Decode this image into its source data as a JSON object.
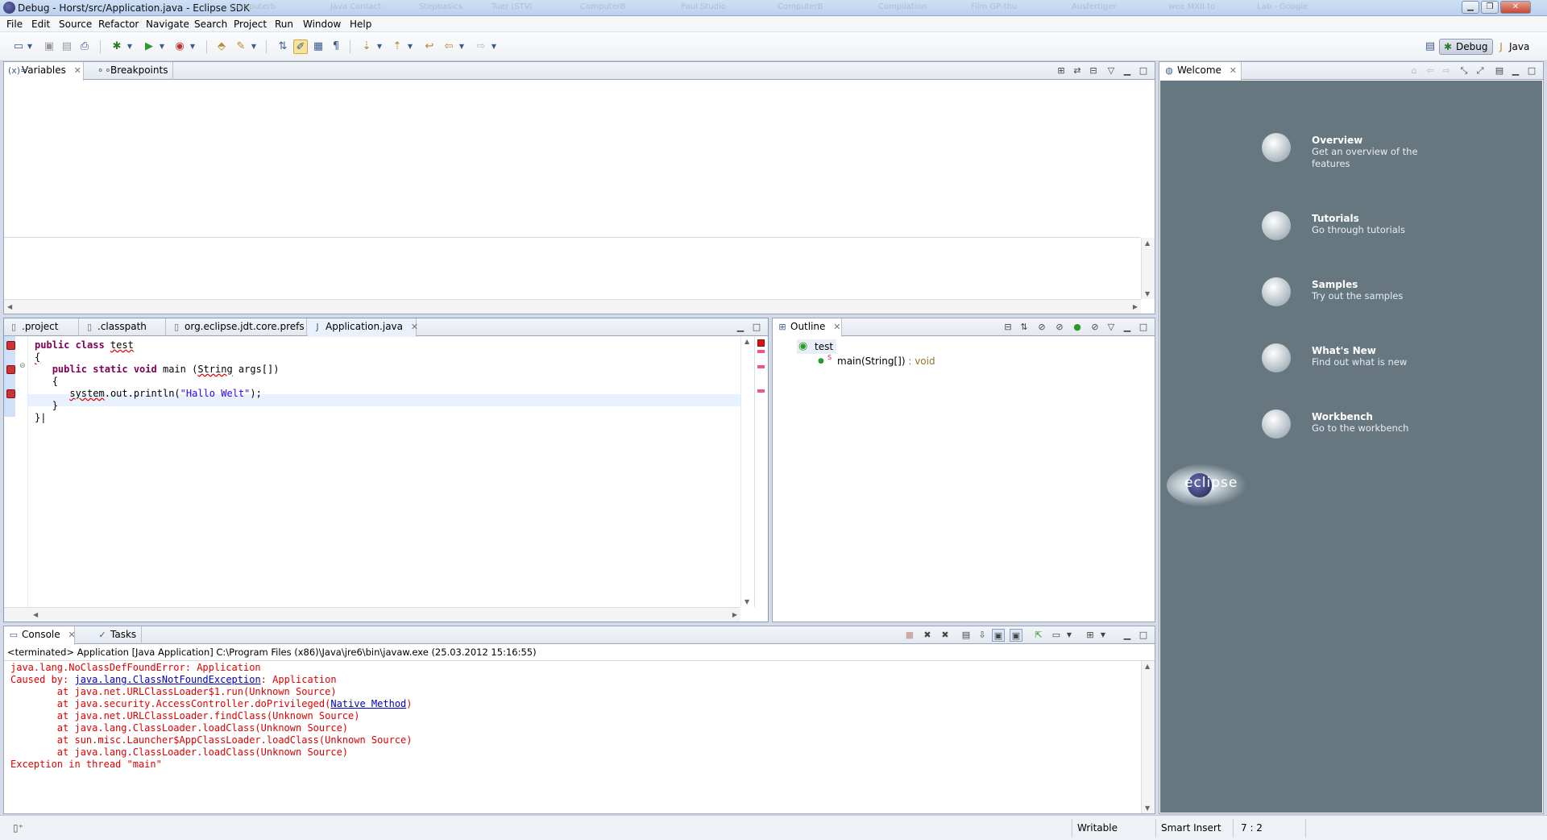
{
  "window": {
    "title": "Debug - Horst/src/Application.java - Eclipse SDK",
    "taskbar_ghosts": [
      "Computerb",
      "Java Contact",
      "Stepbasics",
      "Tuer (STVI",
      "ComputerB",
      "Paul Studio",
      "ComputerB",
      "Compilation",
      "Film GP-thu",
      "Ausfertiger",
      "wee MXII to",
      "Lab - Google"
    ],
    "controls": [
      "minimize",
      "maximize",
      "close"
    ]
  },
  "menu": [
    "File",
    "Edit",
    "Source",
    "Refactor",
    "Navigate",
    "Search",
    "Project",
    "Run",
    "Window",
    "Help"
  ],
  "perspectives": [
    {
      "label": "Debug",
      "active": true
    },
    {
      "label": "Java",
      "active": false
    }
  ],
  "variables_view": {
    "tabs": [
      {
        "label": "Variables",
        "active": true,
        "closable": true
      },
      {
        "label": "Breakpoints",
        "active": false,
        "closable": false
      }
    ]
  },
  "editor": {
    "tabs": [
      {
        "label": ".project",
        "active": false
      },
      {
        "label": ".classpath",
        "active": false
      },
      {
        "label": "org.eclipse.jdt.core.prefs",
        "active": false
      },
      {
        "label": "Application.java",
        "active": true
      }
    ],
    "code": {
      "l1_kw": "public class ",
      "l1_name": "test",
      "l2": "{",
      "l3_kw": "public static void ",
      "l3_rest_a": "main (",
      "l3_type": "String",
      "l3_rest_b": " args[])",
      "l4": "{",
      "l5_err": "system",
      "l5_rest": ".out.println(",
      "l5_str": "\"Hallo Welt\"",
      "l5_end": ");",
      "l6": "}",
      "l7": "}"
    }
  },
  "outline": {
    "tab": "Outline",
    "class_name": "test",
    "method_name": "main(String[])",
    "method_type": " : void",
    "static_marker": "S"
  },
  "welcome": {
    "tab": "Welcome",
    "items": [
      {
        "title": "Overview",
        "desc": "Get an overview of the features"
      },
      {
        "title": "Tutorials",
        "desc": "Go through tutorials"
      },
      {
        "title": "Samples",
        "desc": "Try out the samples"
      },
      {
        "title": "What's New",
        "desc": "Find out what is new"
      },
      {
        "title": "Workbench",
        "desc": "Go to the workbench"
      }
    ],
    "logo": "eclipse"
  },
  "console": {
    "tabs": [
      {
        "label": "Console",
        "active": true
      },
      {
        "label": "Tasks",
        "active": false
      }
    ],
    "header": "<terminated> Application [Java Application] C:\\Program Files (x86)\\Java\\jre6\\bin\\javaw.exe (25.03.2012 15:16:55)",
    "line1": "java.lang.NoClassDefFoundError: Application",
    "line2_a": "Caused by: ",
    "line2_link": "java.lang.ClassNotFoundException",
    "line2_b": ": Application",
    "line3": "\tat java.net.URLClassLoader$1.run(Unknown Source)",
    "line4_a": "\tat java.security.AccessController.doPrivileged(",
    "line4_link": "Native Method",
    "line4_b": ")",
    "line5": "\tat java.net.URLClassLoader.findClass(Unknown Source)",
    "line6": "\tat java.lang.ClassLoader.loadClass(Unknown Source)",
    "line7": "\tat sun.misc.Launcher$AppClassLoader.loadClass(Unknown Source)",
    "line8": "\tat java.lang.ClassLoader.loadClass(Unknown Source)",
    "line9": "Exception in thread \"main\""
  },
  "status": {
    "writable": "Writable",
    "insert_mode": "Smart Insert",
    "position": "7 : 2"
  },
  "colors": {
    "keyword": "#7f0055",
    "string": "#2a00ff",
    "console_error": "#e00000",
    "welcome_bg": "#67777f"
  }
}
